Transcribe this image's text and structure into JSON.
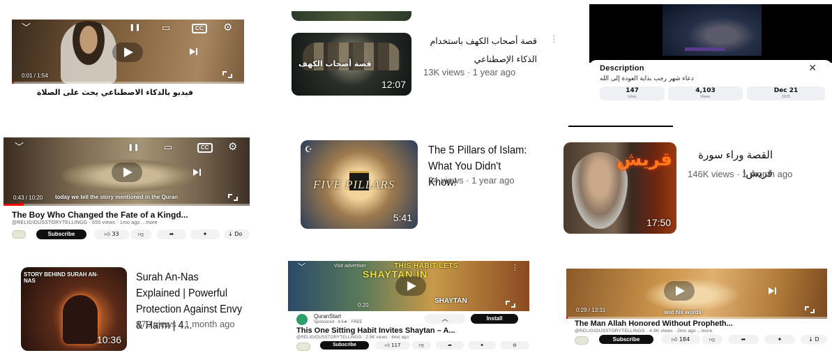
{
  "tile1": {
    "time": "0:01 / 1:54",
    "caption": "فيديو بالذكاء الاصطناعي يحث على الصلاة"
  },
  "tile2": {
    "thumb_text": "قصة أصحاب الكهف",
    "duration": "12:07",
    "title": "قصة أصحاب الكهف باستخدام الذكاء الإصطناعي",
    "meta": "13K views · 1 year ago"
  },
  "tile3": {
    "heading": "Description",
    "arabic_line": "دعاء شهر رجب بداية العودة إلى الله",
    "stats": [
      {
        "value": "147",
        "label": "Likes"
      },
      {
        "value": "4,103",
        "label": "Views"
      },
      {
        "value": "Dec 21",
        "label": "2025"
      }
    ]
  },
  "tile4": {
    "time": "0:43 / 10:20",
    "caption": "today we tell the story mentioned in the Quran",
    "title": "The Boy Who Changed the Fate of a Kingd...",
    "channel": "@RELIGIOUSSTORYTELLINGG · 655 views · 1mo ago ...more",
    "subscribe": "Subscribe",
    "likes": "33",
    "download": "Do"
  },
  "tile5": {
    "thumb_text": "FIVE PILLARS",
    "duration": "5:41",
    "title": "The 5 Pillars of Islam: What You Didn't Know!",
    "meta": "34 views · 1 year ago"
  },
  "tile6": {
    "thumb_text": "قريش",
    "duration": "17:50",
    "title": "القصة وراء سورة قريش!",
    "meta": "146K views · 1 month ago"
  },
  "tile7": {
    "thumb_text": "STORY BEHIND SURAH AN-NAS",
    "duration": "10:36",
    "title": "Surah An-Nas Explained | Powerful Protection Against Envy & Harm | 4...",
    "meta": "970 views · 1 month ago"
  },
  "tile8": {
    "visit": "Visit advertiser",
    "overlay_top": "THIS HABIT LETS",
    "overlay_main": "SHAYTAN IN",
    "overlay_right": "SHAYTAN",
    "time": "0:20",
    "ad_name": "QuranStart",
    "ad_meta": "Sponsored · 4.6★ · FREE",
    "install": "Install",
    "title": "This One Sitting Habit Invites Shaytan – A...",
    "channel": "@RELIGIOUSSTORYTELLINGG · 2.9K views · 6mo ago",
    "subscribe": "Subscribe",
    "likes": "117"
  },
  "tile9": {
    "time": "0:29 / 13:31",
    "caption": "and his words",
    "title": "The Man Allah Honored Without Propheth...",
    "channel": "@RELIGIOUSSTORYTELLINGG · 4.6K views · 2mo ago ...more",
    "subscribe": "Subscribe",
    "likes": "184",
    "download": "D"
  },
  "colors": {
    "accent_red": "#ff0000",
    "text_primary": "#0f0f0f",
    "text_secondary": "#606060"
  }
}
